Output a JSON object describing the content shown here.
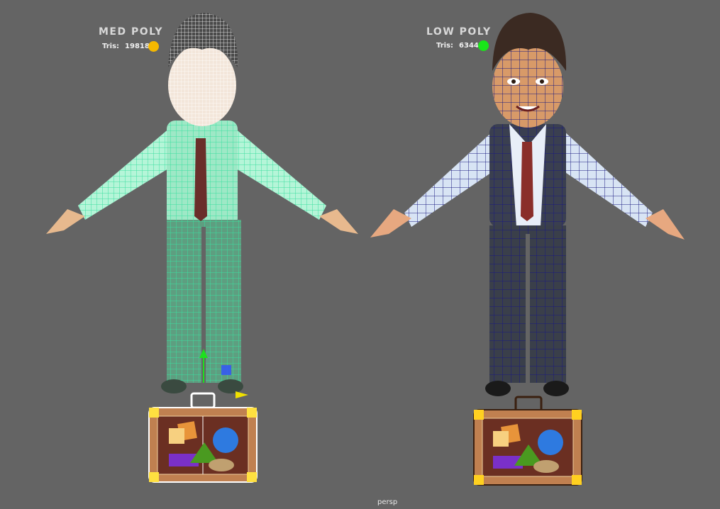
{
  "models": [
    {
      "title": "MED POLY",
      "tris_label": "Tris:",
      "tris": "19818",
      "indicator_color": "#f5b800"
    },
    {
      "title": "LOW POLY",
      "tris_label": "Tris:",
      "tris": "6344",
      "indicator_color": "#19e619"
    }
  ],
  "viewport": {
    "camera": "persp",
    "background": "#646464"
  }
}
